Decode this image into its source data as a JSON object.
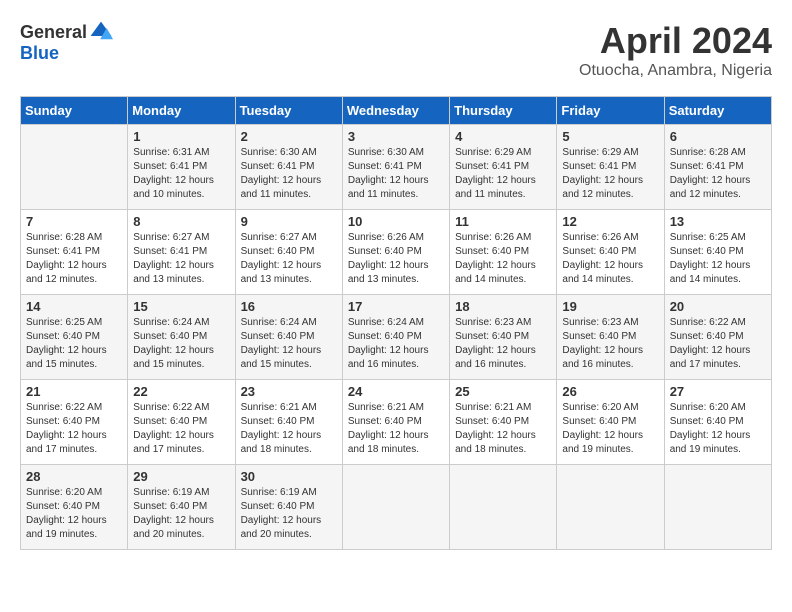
{
  "header": {
    "logo_general": "General",
    "logo_blue": "Blue",
    "title": "April 2024",
    "subtitle": "Otuocha, Anambra, Nigeria"
  },
  "days_of_week": [
    "Sunday",
    "Monday",
    "Tuesday",
    "Wednesday",
    "Thursday",
    "Friday",
    "Saturday"
  ],
  "weeks": [
    [
      {
        "day": "",
        "sunrise": "",
        "sunset": "",
        "daylight": ""
      },
      {
        "day": "1",
        "sunrise": "Sunrise: 6:31 AM",
        "sunset": "Sunset: 6:41 PM",
        "daylight": "Daylight: 12 hours and 10 minutes."
      },
      {
        "day": "2",
        "sunrise": "Sunrise: 6:30 AM",
        "sunset": "Sunset: 6:41 PM",
        "daylight": "Daylight: 12 hours and 11 minutes."
      },
      {
        "day": "3",
        "sunrise": "Sunrise: 6:30 AM",
        "sunset": "Sunset: 6:41 PM",
        "daylight": "Daylight: 12 hours and 11 minutes."
      },
      {
        "day": "4",
        "sunrise": "Sunrise: 6:29 AM",
        "sunset": "Sunset: 6:41 PM",
        "daylight": "Daylight: 12 hours and 11 minutes."
      },
      {
        "day": "5",
        "sunrise": "Sunrise: 6:29 AM",
        "sunset": "Sunset: 6:41 PM",
        "daylight": "Daylight: 12 hours and 12 minutes."
      },
      {
        "day": "6",
        "sunrise": "Sunrise: 6:28 AM",
        "sunset": "Sunset: 6:41 PM",
        "daylight": "Daylight: 12 hours and 12 minutes."
      }
    ],
    [
      {
        "day": "7",
        "sunrise": "Sunrise: 6:28 AM",
        "sunset": "Sunset: 6:41 PM",
        "daylight": "Daylight: 12 hours and 12 minutes."
      },
      {
        "day": "8",
        "sunrise": "Sunrise: 6:27 AM",
        "sunset": "Sunset: 6:41 PM",
        "daylight": "Daylight: 12 hours and 13 minutes."
      },
      {
        "day": "9",
        "sunrise": "Sunrise: 6:27 AM",
        "sunset": "Sunset: 6:40 PM",
        "daylight": "Daylight: 12 hours and 13 minutes."
      },
      {
        "day": "10",
        "sunrise": "Sunrise: 6:26 AM",
        "sunset": "Sunset: 6:40 PM",
        "daylight": "Daylight: 12 hours and 13 minutes."
      },
      {
        "day": "11",
        "sunrise": "Sunrise: 6:26 AM",
        "sunset": "Sunset: 6:40 PM",
        "daylight": "Daylight: 12 hours and 14 minutes."
      },
      {
        "day": "12",
        "sunrise": "Sunrise: 6:26 AM",
        "sunset": "Sunset: 6:40 PM",
        "daylight": "Daylight: 12 hours and 14 minutes."
      },
      {
        "day": "13",
        "sunrise": "Sunrise: 6:25 AM",
        "sunset": "Sunset: 6:40 PM",
        "daylight": "Daylight: 12 hours and 14 minutes."
      }
    ],
    [
      {
        "day": "14",
        "sunrise": "Sunrise: 6:25 AM",
        "sunset": "Sunset: 6:40 PM",
        "daylight": "Daylight: 12 hours and 15 minutes."
      },
      {
        "day": "15",
        "sunrise": "Sunrise: 6:24 AM",
        "sunset": "Sunset: 6:40 PM",
        "daylight": "Daylight: 12 hours and 15 minutes."
      },
      {
        "day": "16",
        "sunrise": "Sunrise: 6:24 AM",
        "sunset": "Sunset: 6:40 PM",
        "daylight": "Daylight: 12 hours and 15 minutes."
      },
      {
        "day": "17",
        "sunrise": "Sunrise: 6:24 AM",
        "sunset": "Sunset: 6:40 PM",
        "daylight": "Daylight: 12 hours and 16 minutes."
      },
      {
        "day": "18",
        "sunrise": "Sunrise: 6:23 AM",
        "sunset": "Sunset: 6:40 PM",
        "daylight": "Daylight: 12 hours and 16 minutes."
      },
      {
        "day": "19",
        "sunrise": "Sunrise: 6:23 AM",
        "sunset": "Sunset: 6:40 PM",
        "daylight": "Daylight: 12 hours and 16 minutes."
      },
      {
        "day": "20",
        "sunrise": "Sunrise: 6:22 AM",
        "sunset": "Sunset: 6:40 PM",
        "daylight": "Daylight: 12 hours and 17 minutes."
      }
    ],
    [
      {
        "day": "21",
        "sunrise": "Sunrise: 6:22 AM",
        "sunset": "Sunset: 6:40 PM",
        "daylight": "Daylight: 12 hours and 17 minutes."
      },
      {
        "day": "22",
        "sunrise": "Sunrise: 6:22 AM",
        "sunset": "Sunset: 6:40 PM",
        "daylight": "Daylight: 12 hours and 17 minutes."
      },
      {
        "day": "23",
        "sunrise": "Sunrise: 6:21 AM",
        "sunset": "Sunset: 6:40 PM",
        "daylight": "Daylight: 12 hours and 18 minutes."
      },
      {
        "day": "24",
        "sunrise": "Sunrise: 6:21 AM",
        "sunset": "Sunset: 6:40 PM",
        "daylight": "Daylight: 12 hours and 18 minutes."
      },
      {
        "day": "25",
        "sunrise": "Sunrise: 6:21 AM",
        "sunset": "Sunset: 6:40 PM",
        "daylight": "Daylight: 12 hours and 18 minutes."
      },
      {
        "day": "26",
        "sunrise": "Sunrise: 6:20 AM",
        "sunset": "Sunset: 6:40 PM",
        "daylight": "Daylight: 12 hours and 19 minutes."
      },
      {
        "day": "27",
        "sunrise": "Sunrise: 6:20 AM",
        "sunset": "Sunset: 6:40 PM",
        "daylight": "Daylight: 12 hours and 19 minutes."
      }
    ],
    [
      {
        "day": "28",
        "sunrise": "Sunrise: 6:20 AM",
        "sunset": "Sunset: 6:40 PM",
        "daylight": "Daylight: 12 hours and 19 minutes."
      },
      {
        "day": "29",
        "sunrise": "Sunrise: 6:19 AM",
        "sunset": "Sunset: 6:40 PM",
        "daylight": "Daylight: 12 hours and 20 minutes."
      },
      {
        "day": "30",
        "sunrise": "Sunrise: 6:19 AM",
        "sunset": "Sunset: 6:40 PM",
        "daylight": "Daylight: 12 hours and 20 minutes."
      },
      {
        "day": "",
        "sunrise": "",
        "sunset": "",
        "daylight": ""
      },
      {
        "day": "",
        "sunrise": "",
        "sunset": "",
        "daylight": ""
      },
      {
        "day": "",
        "sunrise": "",
        "sunset": "",
        "daylight": ""
      },
      {
        "day": "",
        "sunrise": "",
        "sunset": "",
        "daylight": ""
      }
    ]
  ]
}
